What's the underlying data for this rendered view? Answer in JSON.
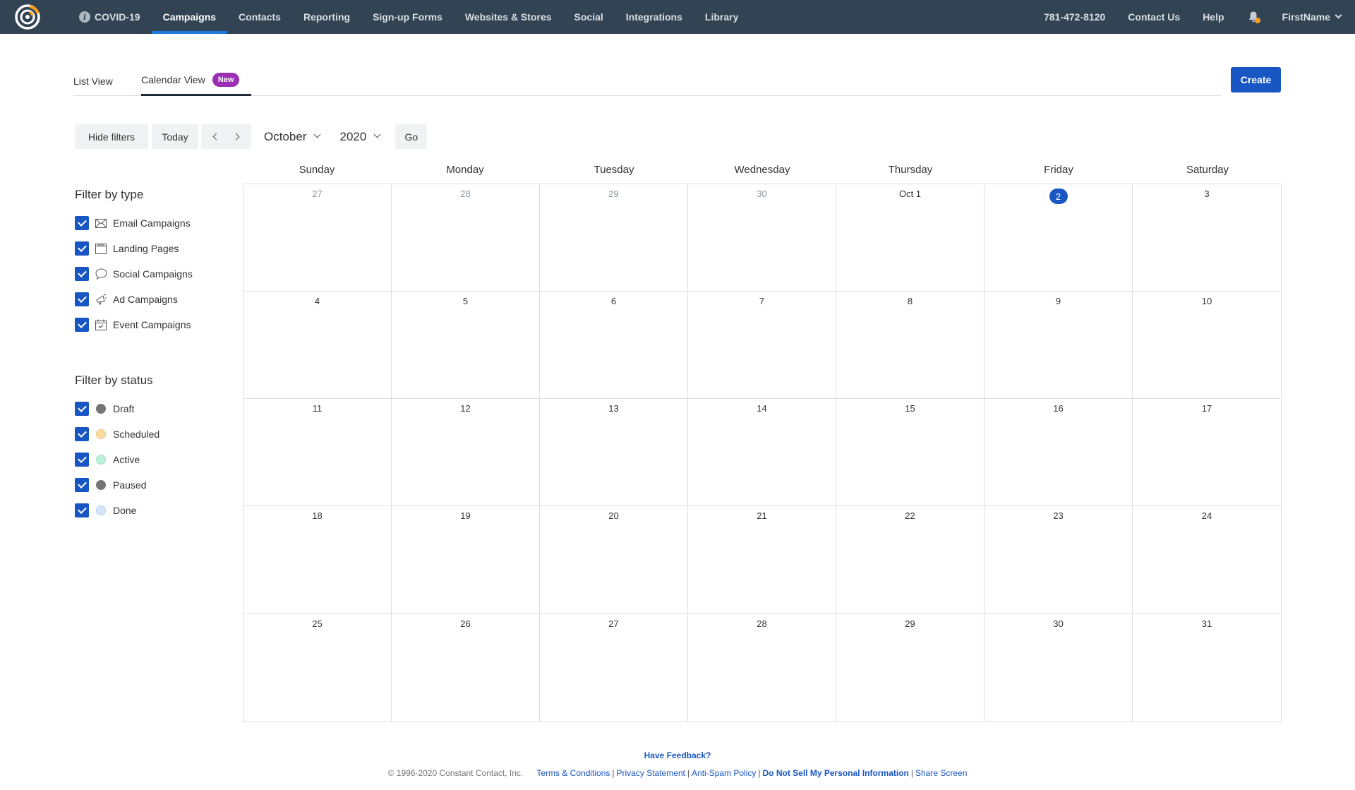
{
  "nav": {
    "covid": "COVID-19",
    "items": [
      "Campaigns",
      "Contacts",
      "Reporting",
      "Sign-up Forms",
      "Websites & Stores",
      "Social",
      "Integrations",
      "Library"
    ],
    "phone": "781-472-8120",
    "contact": "Contact Us",
    "help": "Help",
    "user": "FirstName"
  },
  "tabs": {
    "list": "List View",
    "calendar": "Calendar View",
    "badge": "New"
  },
  "create_label": "Create",
  "toolbar": {
    "hide_filters": "Hide filters",
    "today": "Today",
    "month": "October",
    "year": "2020",
    "go": "Go"
  },
  "filters": {
    "type_title": "Filter by type",
    "types": [
      "Email Campaigns",
      "Landing Pages",
      "Social Campaigns",
      "Ad Campaigns",
      "Event Campaigns"
    ],
    "status_title": "Filter by status",
    "statuses": [
      "Draft",
      "Scheduled",
      "Active",
      "Paused",
      "Done"
    ],
    "status_colors": [
      "#757575",
      "#f9dca3",
      "#bff0dc",
      "#757575",
      "#d6e6fa"
    ]
  },
  "calendar": {
    "days_of_week": [
      "Sunday",
      "Monday",
      "Tuesday",
      "Wednesday",
      "Thursday",
      "Friday",
      "Saturday"
    ],
    "weeks": [
      [
        "27",
        "28",
        "29",
        "30",
        "Oct 1",
        "2",
        "3"
      ],
      [
        "4",
        "5",
        "6",
        "7",
        "8",
        "9",
        "10"
      ],
      [
        "11",
        "12",
        "13",
        "14",
        "15",
        "16",
        "17"
      ],
      [
        "18",
        "19",
        "20",
        "21",
        "22",
        "23",
        "24"
      ],
      [
        "25",
        "26",
        "27",
        "28",
        "29",
        "30",
        "31"
      ]
    ],
    "muted_days": [
      "27",
      "28",
      "29",
      "30"
    ],
    "today": "2"
  },
  "footer": {
    "feedback": "Have Feedback?",
    "copyright": "© 1996-2020 Constant Contact, Inc.",
    "terms": "Terms & Conditions",
    "privacy": "Privacy Statement",
    "antispam": "Anti-Spam Policy",
    "donotsell": "Do Not Sell My Personal Information",
    "share": "Share Screen"
  },
  "colors": {
    "nav_bg": "#324454",
    "accent": "#1856c4",
    "badge": "#9a2fb3"
  }
}
